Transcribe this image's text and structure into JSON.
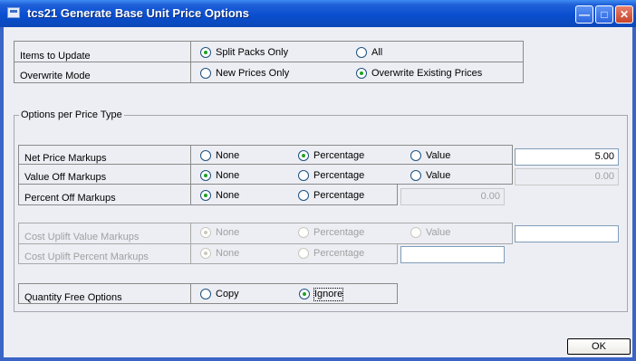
{
  "window": {
    "title": "tcs21 Generate Base Unit Price Options",
    "controls": [
      "minimize-icon",
      "maximize-icon",
      "close-icon"
    ]
  },
  "items_to_update": {
    "label": "Items to Update",
    "options": [
      "Split Packs Only",
      "All"
    ],
    "selected": "Split Packs Only"
  },
  "overwrite_mode": {
    "label": "Overwrite Mode",
    "options": [
      "New Prices Only",
      "Overwrite Existing Prices"
    ],
    "selected": "Overwrite Existing Prices"
  },
  "options_group": {
    "title": "Options per Price Type",
    "net_price": {
      "label": "Net Price Markups",
      "options": [
        "None",
        "Percentage",
        "Value"
      ],
      "selected": "Percentage",
      "value": "5.00"
    },
    "value_off": {
      "label": "Value Off Markups",
      "options": [
        "None",
        "Percentage",
        "Value"
      ],
      "selected": "None",
      "value": "0.00"
    },
    "percent_off": {
      "label": "Percent Off Markups",
      "options": [
        "None",
        "Percentage"
      ],
      "selected": "None",
      "value": "0.00"
    },
    "cost_uplift_value": {
      "label": "Cost Uplift Value Markups",
      "options": [
        "None",
        "Percentage",
        "Value"
      ],
      "selected": "None",
      "value": ""
    },
    "cost_uplift_percent": {
      "label": "Cost Uplift Percent Markups",
      "options": [
        "None",
        "Percentage"
      ],
      "selected": "None",
      "value": ""
    },
    "quantity_free": {
      "label": "Quantity Free Options",
      "options": [
        "Copy",
        "Ignore"
      ],
      "selected": "Ignore"
    }
  },
  "ok_button": {
    "label": "OK"
  }
}
